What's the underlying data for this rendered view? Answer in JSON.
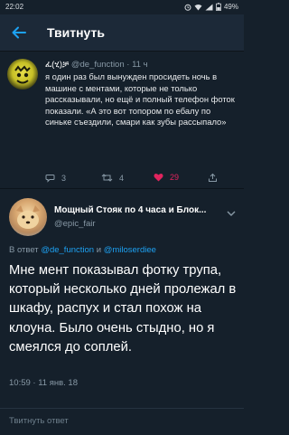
{
  "statusbar": {
    "time": "22:02",
    "battery": "49%"
  },
  "header": {
    "title": "Твитнуть"
  },
  "parent_tweet": {
    "handle": "@de_function",
    "name_glyphs": "ፈ(ሂ)ቻ",
    "age": "11 ч",
    "text": "я один раз был вынужден просидеть ночь в машине с ментами, которые не только рассказывали, но ещё и полный телефон фоток показали. «А это вот топором по ебалу по синьке съездили, смари как зубы рассыпало»",
    "replies": "3",
    "retweets": "4",
    "likes": "29"
  },
  "tweet": {
    "display_name": "Мощный Стояк по 4 часа и Блок...",
    "handle": "@epic_fair",
    "reply_prefix": "В ответ",
    "reply_user1": "@de_function",
    "reply_and": "и",
    "reply_user2": "@miloserdiee",
    "text": "Мне мент показывал фотку трупа, который несколько дней пролежал в шкафу, распух и стал похож на клоуна. Было очень стыдно, но я смеялся до соплей.",
    "timestamp": "10:59 · 11 янв. 18"
  },
  "composer": {
    "placeholder": "Твитнуть ответ"
  },
  "colors": {
    "background": "#15202b",
    "accent": "#1da1f2",
    "like": "#e0245e",
    "muted": "#8899a6"
  }
}
